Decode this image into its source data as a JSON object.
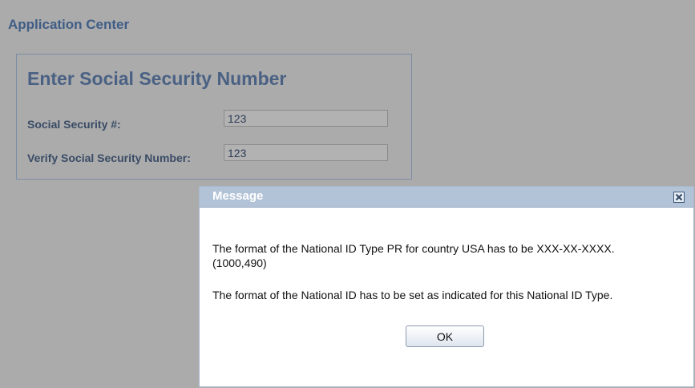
{
  "header": {
    "title": "Application Center"
  },
  "form": {
    "title": "Enter Social Security Number",
    "fields": [
      {
        "label": "Social Security #:",
        "value": "123"
      },
      {
        "label": "Verify Social Security Number:",
        "value": "123"
      }
    ]
  },
  "dialog": {
    "title": "Message",
    "close_icon": "close-x-icon",
    "message_line1": "The format of the National ID Type PR for country USA has to be XXX-XX-XXXX.",
    "message_line2": "(1000,490)",
    "message_line3": "The format of the National ID has to be set as indicated for this National ID Type.",
    "ok_label": "OK"
  },
  "colors": {
    "overlay_background": "#ababab",
    "header_text": "#3f5d86",
    "dialog_header": "#b3c3d7"
  }
}
